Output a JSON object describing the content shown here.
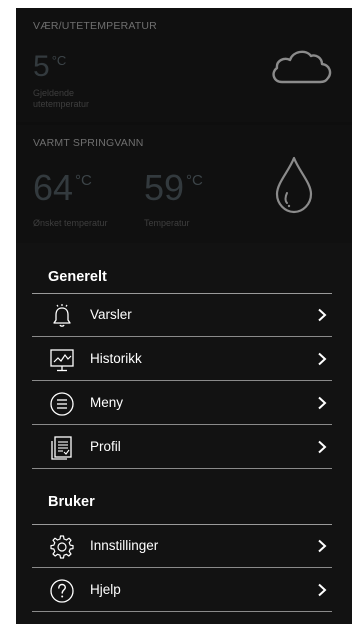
{
  "weather": {
    "title": "VÆR/UTETEMPERATUR",
    "temperature": "5",
    "unit": "°C",
    "label_line1": "Gjeldende",
    "label_line2": "utetemperatur",
    "icon": "cloud-icon"
  },
  "water": {
    "title": "VARMT SPRINGVANN",
    "desired_temperature": "64",
    "desired_unit": "°C",
    "desired_label": "Ønsket temperatur",
    "current_temperature": "59",
    "current_unit": "°C",
    "current_label": "Temperatur",
    "icon": "water-drop-icon"
  },
  "menu": {
    "general_title": "Generelt",
    "general_items": [
      {
        "label": "Varsler",
        "icon": "bell-icon"
      },
      {
        "label": "Historikk",
        "icon": "history-chart-icon"
      },
      {
        "label": "Meny",
        "icon": "menu-list-icon"
      },
      {
        "label": "Profil",
        "icon": "profile-document-icon"
      }
    ],
    "user_title": "Bruker",
    "user_items": [
      {
        "label": "Innstillinger",
        "icon": "gear-icon"
      },
      {
        "label": "Hjelp",
        "icon": "help-icon"
      }
    ]
  },
  "colors": {
    "background": "#0e0e0e",
    "text": "#ffffff",
    "dim_text": "#6f6f6f",
    "divider": "#8a8a8a"
  }
}
